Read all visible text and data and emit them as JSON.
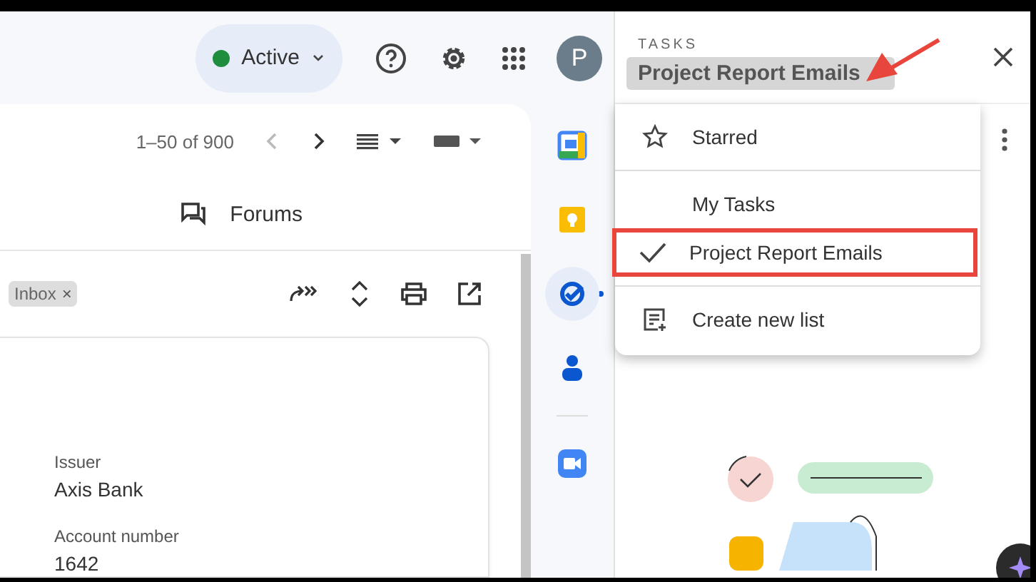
{
  "top_bar": {
    "status": {
      "label": "Active",
      "color": "#1e8e3e"
    },
    "avatar": "P"
  },
  "mail": {
    "pagination": "1–50 of 900",
    "tab": "Forums",
    "label_chip": {
      "label": "Inbox",
      "remove": "×"
    },
    "fields": [
      {
        "label": "Issuer",
        "value": "Axis Bank"
      },
      {
        "label": "Account number",
        "value": "1642"
      }
    ]
  },
  "side_apps": [
    {
      "kind": "calendar",
      "selected": false
    },
    {
      "kind": "keep",
      "selected": false
    },
    {
      "kind": "tasks",
      "selected": true
    },
    {
      "kind": "contacts",
      "selected": false
    },
    {
      "kind": "meet",
      "selected": false
    }
  ],
  "tasks": {
    "heading": "TASKS",
    "list_title": "Project Report Emails",
    "title_arrow": true,
    "menu": [
      {
        "kind": "starred",
        "label": "Starred",
        "annotated": false
      },
      {
        "kind": "list",
        "label": "My Tasks",
        "selected": false,
        "annotated": false
      },
      {
        "kind": "list",
        "label": "Project Report Emails",
        "selected": true,
        "annotated": true
      },
      {
        "kind": "create",
        "label": "Create new list",
        "annotated": false
      }
    ]
  }
}
